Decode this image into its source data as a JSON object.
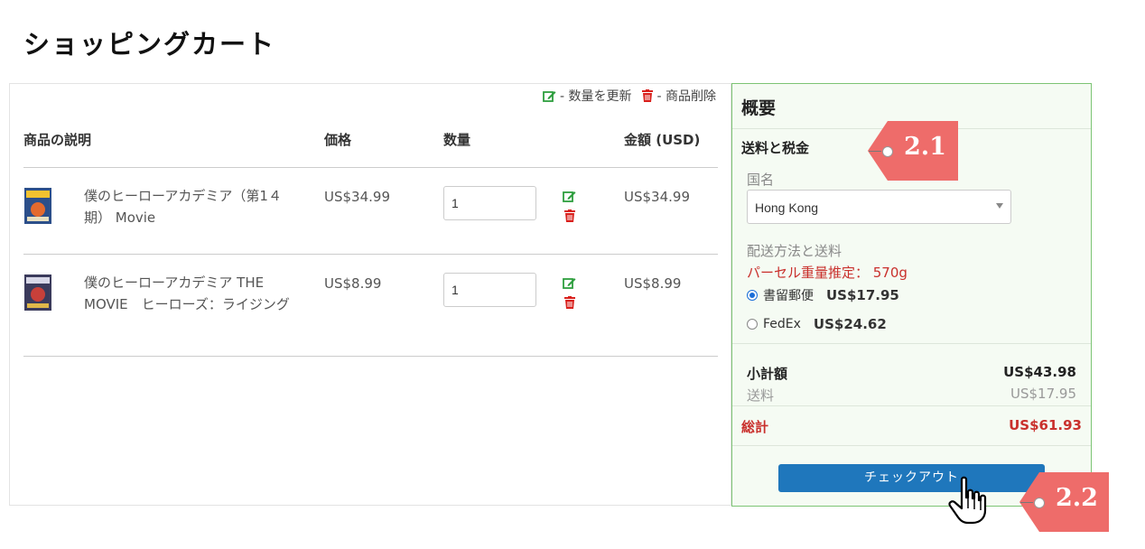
{
  "page": {
    "title": "ショッピングカート"
  },
  "legend": {
    "update_label": "- 数量を更新",
    "delete_label": "- 商品削除"
  },
  "table": {
    "headers": {
      "description": "商品の説明",
      "price": "価格",
      "quantity": "数量",
      "total": "金額 (USD)"
    },
    "rows": [
      {
        "description": "僕のヒーローアカデミア（第1４期） Movie",
        "price": "US$34.99",
        "quantity": "1",
        "total": "US$34.99"
      },
      {
        "description": "僕のヒーローアカデミア THE MOVIE　ヒーローズ：ライジング",
        "price": "US$8.99",
        "quantity": "1",
        "total": "US$8.99"
      }
    ]
  },
  "summary": {
    "title": "概要",
    "shipping_title": "送料と税金",
    "country_label": "国名",
    "country_value": "Hong Kong",
    "method_label": "配送方法と送料",
    "weight_text": "パーセル重量推定： 570g",
    "options": [
      {
        "name": "書留郵便",
        "amount": "US$17.95",
        "selected": true
      },
      {
        "name": "FedEx",
        "amount": "US$24.62",
        "selected": false
      }
    ],
    "subtotal_label": "小計額",
    "subtotal_value": "US$43.98",
    "shipping_label": "送料",
    "shipping_value": "US$17.95",
    "grand_total_label": "総計",
    "grand_total_value": "US$61.93",
    "checkout_label": "チェックアウト"
  },
  "callouts": {
    "step1": "2.1",
    "step2": "2.2"
  },
  "colors": {
    "accent_blue": "#1f77bc",
    "total_red": "#c9302c",
    "edit_green": "#2e9e3e",
    "delete_red": "#d9201c",
    "tag_red": "#ee6c6a"
  }
}
